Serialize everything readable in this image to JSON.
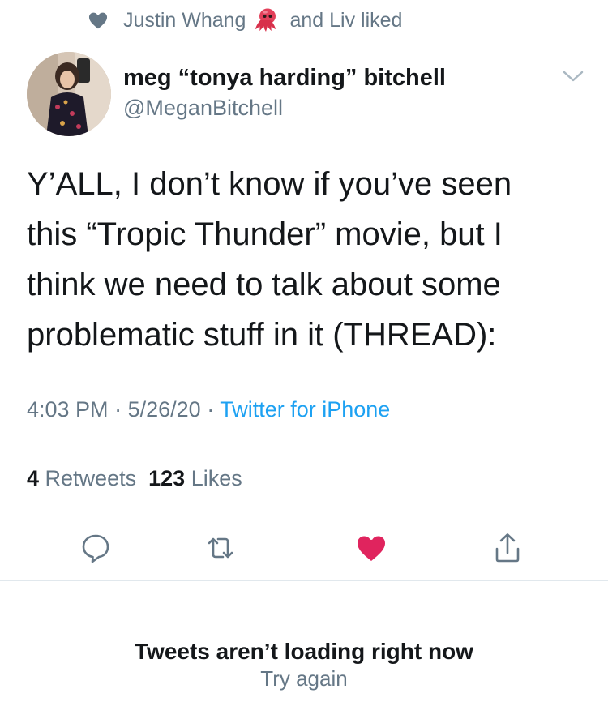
{
  "social_context": {
    "liker_1": "Justin Whang",
    "emoji_icon": "octopus-emoji",
    "suffix": "and Liv liked"
  },
  "author": {
    "display_name": "meg “tonya harding” bitchell",
    "handle": "@MeganBitchell"
  },
  "tweet": {
    "lines": [
      "Y’ALL, I don’t know if you’ve seen",
      "this “Tropic Thunder” movie, but I",
      "think we need to talk about some",
      "problematic stuff in it (THREAD):"
    ],
    "time": "4:03 PM",
    "date": "5/26/20",
    "separator": "·",
    "source": "Twitter for iPhone"
  },
  "stats": {
    "retweets_count": "4",
    "retweets_label": "Retweets",
    "likes_count": "123",
    "likes_label": "Likes"
  },
  "actions": {
    "reply_icon": "reply-icon",
    "retweet_icon": "retweet-icon",
    "like_icon": "heart-icon",
    "share_icon": "share-icon",
    "liked": true
  },
  "footer": {
    "title": "Tweets aren’t loading right now",
    "retry": "Try again"
  },
  "colors": {
    "text": "#14171a",
    "secondary": "#657786",
    "link": "#1da1f2",
    "like": "#e0245e",
    "divider": "#e1e8ed"
  }
}
